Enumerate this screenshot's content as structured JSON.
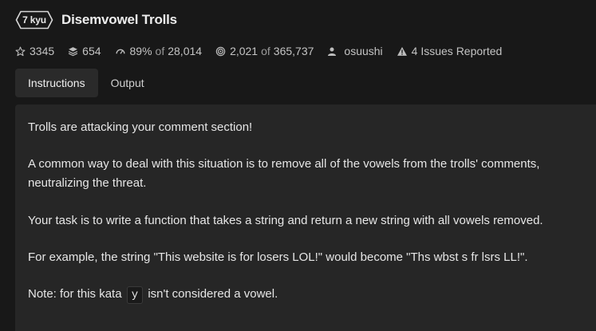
{
  "kata": {
    "rank": "7 kyu",
    "title": "Disemvowel Trolls"
  },
  "stats": {
    "stars": "3345",
    "collections": "654",
    "satisfaction": "89%",
    "of_word": "of",
    "satisfaction_votes": "28,014",
    "completed": "2,021",
    "completed_total": "365,737",
    "author": "osuushi",
    "issues": "4 Issues Reported"
  },
  "tabs": [
    {
      "label": "Instructions",
      "active": true
    },
    {
      "label": "Output",
      "active": false
    }
  ],
  "instructions": {
    "p1": "Trolls are attacking your comment section!",
    "p2": "A common way to deal with this situation is to remove all of the vowels from the trolls' comments, neutralizing the threat.",
    "p3": "Your task is to write a function that takes a string and return a new string with all vowels removed.",
    "p4": "For example, the string \"This website is for losers LOL!\" would become \"Ths wbst s fr lsrs LL!\".",
    "p5_before": "Note: for this kata",
    "p5_code": "y",
    "p5_after": "isn't considered a vowel."
  },
  "colors": {
    "background": "#181818",
    "panel": "#262626",
    "active_tab": "#2a2a2a"
  }
}
